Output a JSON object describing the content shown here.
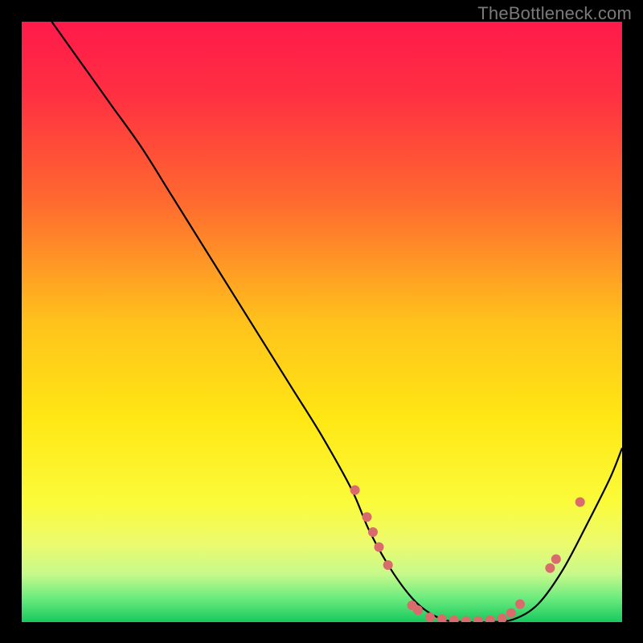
{
  "attribution": "TheBottleneck.com",
  "chart_data": {
    "type": "line",
    "title": "",
    "xlabel": "",
    "ylabel": "",
    "xlim": [
      0,
      100
    ],
    "ylim": [
      0,
      100
    ],
    "gradient_stops": [
      {
        "offset": 0.0,
        "color": "#ff1a4b"
      },
      {
        "offset": 0.12,
        "color": "#ff2f42"
      },
      {
        "offset": 0.3,
        "color": "#ff6a2f"
      },
      {
        "offset": 0.5,
        "color": "#ffc21c"
      },
      {
        "offset": 0.66,
        "color": "#ffe714"
      },
      {
        "offset": 0.8,
        "color": "#fbfb3a"
      },
      {
        "offset": 0.87,
        "color": "#ecfb6e"
      },
      {
        "offset": 0.92,
        "color": "#c7f98b"
      },
      {
        "offset": 0.96,
        "color": "#6ceb7e"
      },
      {
        "offset": 1.0,
        "color": "#17c95e"
      }
    ],
    "series": [
      {
        "name": "bottleneck-curve",
        "x": [
          5,
          10,
          15,
          20,
          25,
          30,
          35,
          40,
          45,
          50,
          55,
          58,
          62,
          66,
          70,
          74,
          78,
          82,
          86,
          90,
          94,
          98,
          100
        ],
        "y": [
          100,
          93,
          86,
          79,
          71,
          63,
          55,
          47,
          39,
          31,
          22,
          15,
          8,
          3,
          0.5,
          0,
          0,
          0.5,
          3,
          8.5,
          16,
          24,
          29
        ]
      }
    ],
    "markers": [
      {
        "x": 55.5,
        "y": 22.0
      },
      {
        "x": 57.5,
        "y": 17.5
      },
      {
        "x": 58.5,
        "y": 15.0
      },
      {
        "x": 59.5,
        "y": 12.5
      },
      {
        "x": 61.0,
        "y": 9.5
      },
      {
        "x": 65.0,
        "y": 2.8
      },
      {
        "x": 66.0,
        "y": 2.0
      },
      {
        "x": 68.0,
        "y": 0.8
      },
      {
        "x": 70.0,
        "y": 0.5
      },
      {
        "x": 72.0,
        "y": 0.3
      },
      {
        "x": 74.0,
        "y": 0.2
      },
      {
        "x": 76.0,
        "y": 0.2
      },
      {
        "x": 78.0,
        "y": 0.3
      },
      {
        "x": 80.0,
        "y": 0.6
      },
      {
        "x": 81.5,
        "y": 1.5
      },
      {
        "x": 83.0,
        "y": 3.0
      },
      {
        "x": 88.0,
        "y": 9.0
      },
      {
        "x": 89.0,
        "y": 10.5
      },
      {
        "x": 93.0,
        "y": 20.0
      }
    ],
    "marker_style": {
      "r": 6,
      "fill": "#d96b6c"
    }
  }
}
